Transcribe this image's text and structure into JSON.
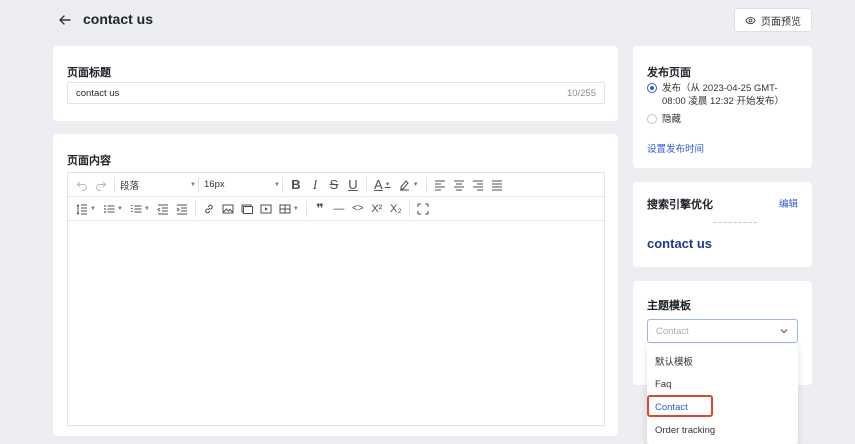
{
  "header": {
    "page_name": "contact us",
    "preview_label": "页面预览"
  },
  "title_section": {
    "label": "页面标题",
    "value": "contact us",
    "count": "10/255"
  },
  "content_section": {
    "label": "页面内容",
    "toolbar": {
      "paragraph_select": "段落",
      "font_size_select": "16px"
    }
  },
  "publish": {
    "title": "发布页面",
    "publish_option": "发布（从 2023-04-25 GMT-08:00 凌晨 12:32 开始发布）",
    "hide_option": "隐藏",
    "set_time_link": "设置发布时间"
  },
  "seo": {
    "title": "搜索引擎优化",
    "edit_label": "编辑",
    "preview_title": "contact us"
  },
  "theme": {
    "title": "主题模板",
    "placeholder": "Contact",
    "options": [
      "默认模板",
      "Faq",
      "Contact",
      "Order tracking"
    ],
    "highlighted": "Contact"
  },
  "colors": {
    "accent": "#2d5bd6",
    "highlight": "#e0462f",
    "background": "#eceef2"
  }
}
